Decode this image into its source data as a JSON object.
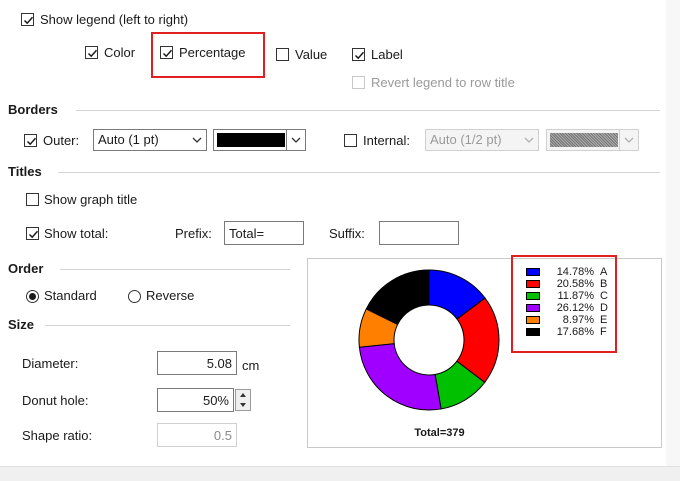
{
  "legend_options": {
    "show_legend": {
      "label": "Show legend (left to right)",
      "checked": true
    },
    "color": {
      "label": "Color",
      "checked": true
    },
    "percentage": {
      "label": "Percentage",
      "checked": true
    },
    "value": {
      "label": "Value",
      "checked": false
    },
    "label": {
      "label": "Label",
      "checked": true
    },
    "revert": {
      "label": "Revert legend to row title",
      "checked": false,
      "disabled": true
    }
  },
  "borders": {
    "title": "Borders",
    "outer": {
      "label": "Outer:",
      "checked": true,
      "width": "Auto (1 pt)",
      "color": "#000000"
    },
    "internal": {
      "label": "Internal:",
      "checked": false,
      "width": "Auto (1/2 pt)",
      "disabled": true
    }
  },
  "titles": {
    "title": "Titles",
    "show_graph_title": {
      "label": "Show graph title",
      "checked": false
    },
    "show_total": {
      "label": "Show total:",
      "checked": true
    },
    "prefix": {
      "label": "Prefix:",
      "value": "Total="
    },
    "suffix": {
      "label": "Suffix:",
      "value": ""
    }
  },
  "order": {
    "title": "Order",
    "standard": {
      "label": "Standard",
      "selected": true
    },
    "reverse": {
      "label": "Reverse",
      "selected": false
    }
  },
  "size": {
    "title": "Size",
    "diameter": {
      "label": "Diameter:",
      "value": "5.08",
      "unit": "cm"
    },
    "donut_hole": {
      "label": "Donut hole:",
      "value": "50%"
    },
    "shape_ratio": {
      "label": "Shape ratio:",
      "value": "0.5",
      "disabled": true
    }
  },
  "chart_data": {
    "type": "pie",
    "variant": "donut",
    "categories": [
      "A",
      "B",
      "C",
      "D",
      "E",
      "F"
    ],
    "values": [
      14.78,
      20.58,
      11.87,
      26.12,
      8.97,
      17.68
    ],
    "percent_labels": [
      "14.78%",
      "20.58%",
      "11.87%",
      "26.12%",
      "8.97%",
      "17.68%"
    ],
    "colors": [
      "#0000ff",
      "#ff0000",
      "#00c000",
      "#a000ff",
      "#ff8000",
      "#000000"
    ],
    "total_label": "Total=379",
    "legend_position": "top-right"
  }
}
